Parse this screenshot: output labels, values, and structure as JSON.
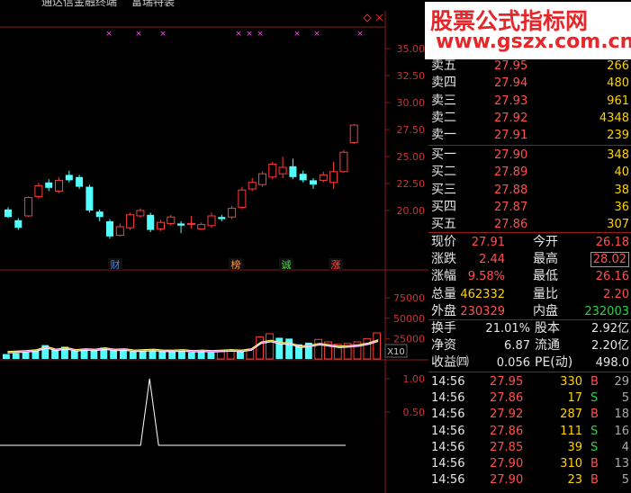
{
  "topbar": {
    "app_title": "通达信金融终端",
    "menu_item": "富瑞特装"
  },
  "watermark": {
    "line1": "股票公式指标网",
    "line2": "www.gszx.com.cn"
  },
  "colors": {
    "up": "#ff3c3c",
    "down": "#54ffff",
    "grid": "#8b1a1a",
    "ma_white": "#ffffff",
    "ma_yellow": "#ffff66",
    "ma_magenta": "#ff66ff"
  },
  "price_axis": [
    "35.00",
    "32.50",
    "30.00",
    "27.50",
    "25.00",
    "22.50",
    "20.00"
  ],
  "volume_axis": [
    "75000",
    "50000",
    "25000"
  ],
  "volume_unit": "X10",
  "indicator_axis": [
    "1.00",
    "0.50"
  ],
  "events": [
    "财",
    "榜",
    "诚",
    "涨"
  ],
  "chart_data": {
    "type": "candlestick",
    "ylim": [
      17.5,
      36.5
    ],
    "candles": [
      {
        "o": 20.1,
        "c": 19.4,
        "h": 20.3,
        "l": 19.3
      },
      {
        "o": 19.1,
        "c": 18.4,
        "h": 19.3,
        "l": 18.2
      },
      {
        "o": 19.5,
        "c": 21.2,
        "h": 21.3,
        "l": 19.4
      },
      {
        "o": 21.3,
        "c": 22.3,
        "h": 22.6,
        "l": 21.1
      },
      {
        "o": 22.6,
        "c": 22.1,
        "h": 22.9,
        "l": 21.8
      },
      {
        "o": 21.8,
        "c": 22.8,
        "h": 23.1,
        "l": 21.6
      },
      {
        "o": 23.3,
        "c": 22.8,
        "h": 23.7,
        "l": 22.6
      },
      {
        "o": 23.1,
        "c": 22.2,
        "h": 23.3,
        "l": 22.0
      },
      {
        "o": 22.2,
        "c": 20.0,
        "h": 22.4,
        "l": 19.8
      },
      {
        "o": 19.9,
        "c": 19.4,
        "h": 20.1,
        "l": 19.0
      },
      {
        "o": 19.0,
        "c": 17.6,
        "h": 19.2,
        "l": 17.4
      },
      {
        "o": 17.7,
        "c": 18.5,
        "h": 18.8,
        "l": 17.6
      },
      {
        "o": 18.4,
        "c": 19.6,
        "h": 19.8,
        "l": 18.2
      },
      {
        "o": 19.5,
        "c": 20.0,
        "h": 20.2,
        "l": 19.3
      },
      {
        "o": 19.6,
        "c": 18.2,
        "h": 19.8,
        "l": 18.0
      },
      {
        "o": 18.3,
        "c": 18.9,
        "h": 19.1,
        "l": 18.1
      },
      {
        "o": 18.8,
        "c": 19.4,
        "h": 19.6,
        "l": 18.6
      },
      {
        "o": 18.8,
        "c": 18.6,
        "h": 19.0,
        "l": 17.9
      },
      {
        "o": 18.7,
        "c": 18.8,
        "h": 19.5,
        "l": 18.3
      },
      {
        "o": 18.3,
        "c": 18.7,
        "h": 18.9,
        "l": 18.2
      },
      {
        "o": 18.6,
        "c": 19.5,
        "h": 19.8,
        "l": 18.4
      },
      {
        "o": 19.4,
        "c": 19.2,
        "h": 19.6,
        "l": 19.0
      },
      {
        "o": 19.4,
        "c": 20.2,
        "h": 20.4,
        "l": 19.2
      },
      {
        "o": 20.3,
        "c": 21.9,
        "h": 22.2,
        "l": 20.1
      },
      {
        "o": 22.0,
        "c": 22.6,
        "h": 23.0,
        "l": 21.8
      },
      {
        "o": 22.4,
        "c": 23.4,
        "h": 23.6,
        "l": 22.2
      },
      {
        "o": 23.1,
        "c": 24.3,
        "h": 24.5,
        "l": 22.9
      },
      {
        "o": 23.4,
        "c": 24.0,
        "h": 25.0,
        "l": 23.0
      },
      {
        "o": 24.1,
        "c": 23.1,
        "h": 24.8,
        "l": 22.9
      },
      {
        "o": 23.4,
        "c": 22.8,
        "h": 23.7,
        "l": 22.6
      },
      {
        "o": 22.8,
        "c": 22.4,
        "h": 23.0,
        "l": 22.0
      },
      {
        "o": 22.8,
        "c": 23.3,
        "h": 23.6,
        "l": 22.6
      },
      {
        "o": 22.6,
        "c": 23.6,
        "h": 24.5,
        "l": 22.0
      },
      {
        "o": 23.6,
        "c": 25.4,
        "h": 25.6,
        "l": 23.5
      },
      {
        "o": 26.3,
        "c": 27.91,
        "h": 28.02,
        "l": 26.16
      }
    ],
    "volumes": [
      0.3,
      0.35,
      0.4,
      0.5,
      0.85,
      0.55,
      0.75,
      0.5,
      0.6,
      0.55,
      0.7,
      0.55,
      0.6,
      0.45,
      0.5,
      0.55,
      0.45,
      0.45,
      0.5,
      0.4,
      0.45,
      0.4,
      0.45,
      0.5,
      0.45,
      0.6,
      1.35,
      1.55,
      1.3,
      1.25,
      0.9,
      1.0,
      1.2,
      1.05,
      0.9,
      0.95,
      1.05,
      1.25,
      1.6
    ],
    "volume_ylim": [
      0,
      84000
    ],
    "indicator_ylim": [
      0,
      1.2
    ],
    "indicator_spike_index": 14
  },
  "quote": {
    "sell": [
      {
        "label": "卖五",
        "price": "27.95",
        "vol": "266"
      },
      {
        "label": "卖四",
        "price": "27.94",
        "vol": "480"
      },
      {
        "label": "卖三",
        "price": "27.93",
        "vol": "961"
      },
      {
        "label": "卖二",
        "price": "27.92",
        "vol": "4348"
      },
      {
        "label": "卖一",
        "price": "27.91",
        "vol": "239"
      }
    ],
    "buy": [
      {
        "label": "买一",
        "price": "27.90",
        "vol": "348"
      },
      {
        "label": "买二",
        "price": "27.89",
        "vol": "40"
      },
      {
        "label": "买三",
        "price": "27.88",
        "vol": "38"
      },
      {
        "label": "买四",
        "price": "27.87",
        "vol": "36"
      },
      {
        "label": "买五",
        "price": "27.86",
        "vol": "307"
      }
    ],
    "stats": [
      {
        "l1": "现价",
        "v1": "27.91",
        "l2": "今开",
        "v2": "26.18"
      },
      {
        "l1": "涨跌",
        "v1": "2.44",
        "l2": "最高",
        "v2": "28.02"
      },
      {
        "l1": "涨幅",
        "v1": "9.58%",
        "l2": "最低",
        "v2": "26.16"
      },
      {
        "l1": "总量",
        "v1": "462332",
        "l2": "量比",
        "v2": "2.20"
      },
      {
        "l1": "外盘",
        "v1": "230329",
        "l2": "内盘",
        "v2": "232003"
      }
    ],
    "fund": [
      {
        "l1": "换手",
        "v1": "21.01%",
        "l2": "股本",
        "v2": "2.92亿"
      },
      {
        "l1": "净资",
        "v1": "6.87",
        "l2": "流通",
        "v2": "2.20亿"
      },
      {
        "l1": "收益㈣",
        "v1": "0.056",
        "l2": "PE(动)",
        "v2": "498.0"
      }
    ],
    "ticks": [
      {
        "time": "14:56",
        "price": "27.95",
        "vol": "330",
        "bs": "B",
        "n": "29"
      },
      {
        "time": "14:56",
        "price": "27.86",
        "vol": "17",
        "bs": "S",
        "n": "5"
      },
      {
        "time": "14:56",
        "price": "27.92",
        "vol": "287",
        "bs": "B",
        "n": "18"
      },
      {
        "time": "14:56",
        "price": "27.86",
        "vol": "111",
        "bs": "S",
        "n": "16"
      },
      {
        "time": "14:56",
        "price": "27.85",
        "vol": "39",
        "bs": "S",
        "n": "4"
      },
      {
        "time": "14:56",
        "price": "27.90",
        "vol": "310",
        "bs": "B",
        "n": "13"
      },
      {
        "time": "14:56",
        "price": "27.90",
        "vol": "23",
        "bs": "B",
        "n": "5"
      }
    ]
  }
}
